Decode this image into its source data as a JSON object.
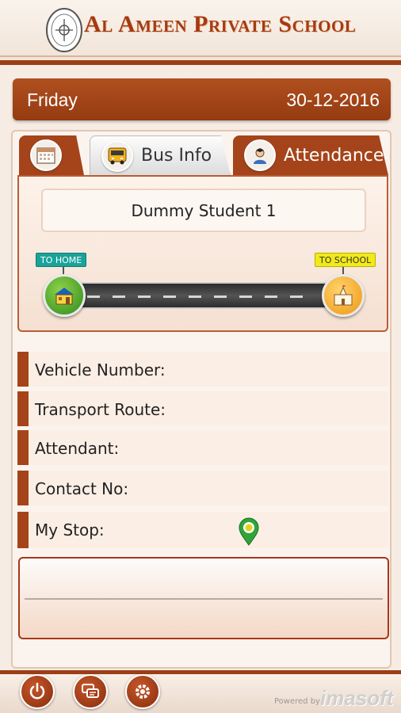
{
  "header": {
    "school_name": "Al Ameen Private School",
    "colors": {
      "brand": "#a63a12",
      "accent": "#9b3f16"
    }
  },
  "datebar": {
    "day": "Friday",
    "date": "30-12-2016"
  },
  "tabs": [
    {
      "id": "calendar",
      "label": "",
      "icon": "calendar-icon",
      "active": false
    },
    {
      "id": "bus",
      "label": "Bus Info",
      "icon": "bus-icon",
      "active": true
    },
    {
      "id": "attendance",
      "label": "Attendance",
      "icon": "student-icon",
      "active": false
    }
  ],
  "bus": {
    "student_name": "Dummy Student 1",
    "to_home_label": "TO HOME",
    "to_school_label": "TO SCHOOL"
  },
  "info_rows": [
    {
      "label": "Vehicle Number:"
    },
    {
      "label": "Transport Route:"
    },
    {
      "label": "Attendant:"
    },
    {
      "label": "Contact No:"
    },
    {
      "label": "My Stop:"
    }
  ],
  "footer": {
    "buttons": [
      {
        "name": "power-icon"
      },
      {
        "name": "messages-icon"
      },
      {
        "name": "settings-icon"
      }
    ],
    "powered_by": "Powered by",
    "brand": "imasoft"
  }
}
